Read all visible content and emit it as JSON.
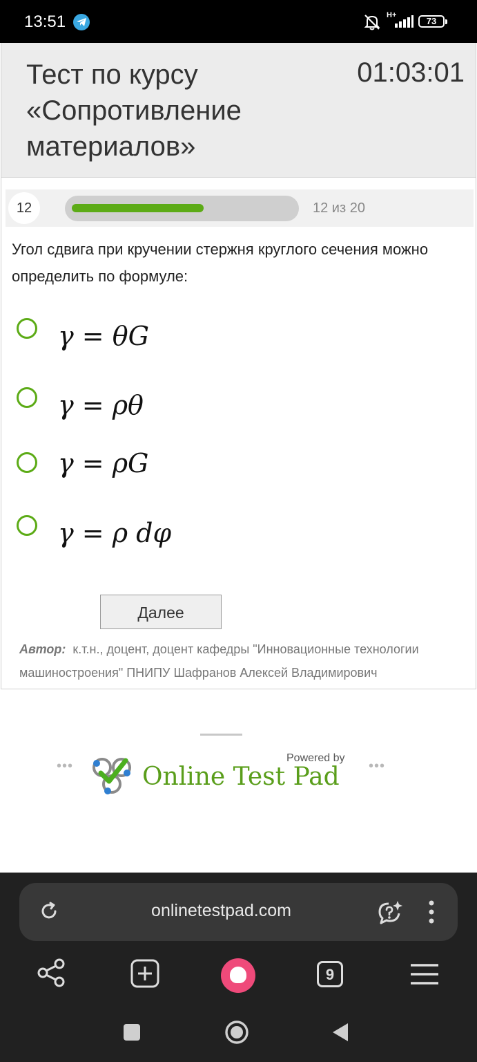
{
  "status_bar": {
    "time": "13:51",
    "network": "H+",
    "battery": "73",
    "icons": [
      "telegram-icon",
      "muted-bell-icon",
      "signal-icon",
      "battery-icon"
    ]
  },
  "test": {
    "title": "Тест по курсу «Сопротивление материалов»",
    "timer": "01:03:01",
    "question_number": "12",
    "progress_text": "12 из 20",
    "progress_fraction": 0.6,
    "question": "Угол сдвига при кручении стержня круглого сечения можно определить по формуле:",
    "options": [
      {
        "formula": "γ = θG"
      },
      {
        "formula": "γ = ρθ"
      },
      {
        "formula": "γ = ρG"
      },
      {
        "formula": "γ = ρ dφ"
      }
    ],
    "next_label": "Далее",
    "author_label": "Автор:",
    "author_text": "к.т.н., доцент, доцент кафедры \"Инновационные технологии машиностроения\" ПНИПУ Шафранов Алексей Владимирович"
  },
  "footer": {
    "powered_by": "Powered by",
    "brand": "Online Test Pad"
  },
  "browser": {
    "url": "onlinetestpad.com",
    "tab_count": "9"
  },
  "colors": {
    "accent_green": "#5cab16",
    "header_bg": "#ececec",
    "browser_bg": "#212121",
    "alice_pink": "#ef4a7a"
  }
}
